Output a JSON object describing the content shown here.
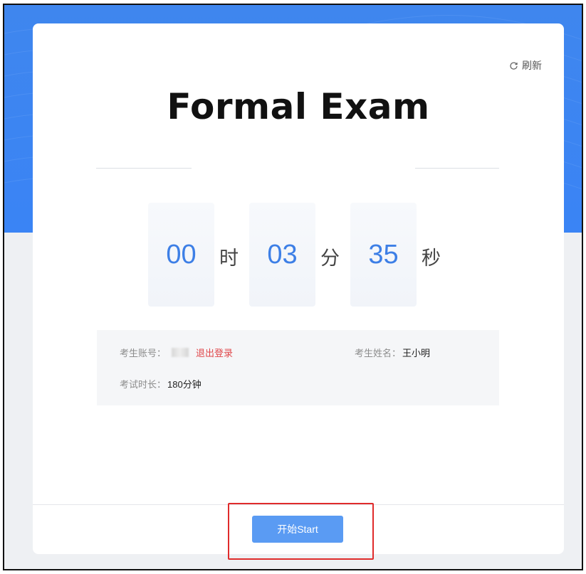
{
  "header": {
    "refresh_label": "刷新",
    "refresh_icon": "refresh-icon",
    "title": "Formal Exam"
  },
  "countdown": {
    "hours": "00",
    "hours_unit": "时",
    "minutes": "03",
    "minutes_unit": "分",
    "seconds": "35",
    "seconds_unit": "秒"
  },
  "info": {
    "account_label": "考生账号：",
    "logout_label": "退出登录",
    "name_label": "考生姓名：",
    "name_value": "王小明",
    "duration_label": "考试时长：",
    "duration_value": "180分钟"
  },
  "footer": {
    "start_label": "开始Start"
  },
  "colors": {
    "brand_blue": "#3a84f5",
    "digit_blue": "#3d7fe6",
    "button_blue": "#5a9bf3",
    "logout_red": "#e0474a",
    "highlight_red": "#e02b2b"
  }
}
